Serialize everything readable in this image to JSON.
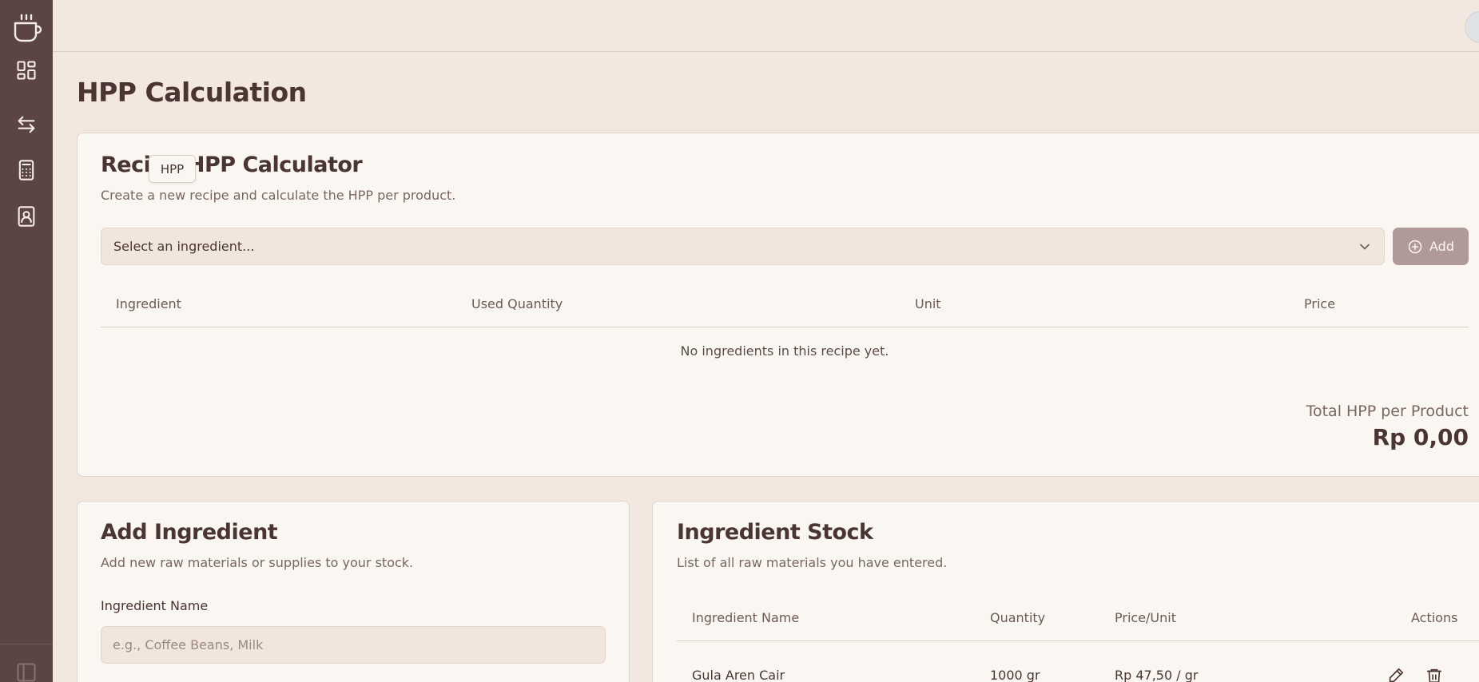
{
  "sidebar": {
    "items": [
      {
        "name": "coffee-cup-logo-icon"
      },
      {
        "name": "dashboard-grid-icon"
      },
      {
        "name": "transfer-arrows-icon"
      },
      {
        "name": "calculator-icon"
      },
      {
        "name": "contact-book-icon"
      },
      {
        "name": "collapse-sidebar-icon"
      }
    ]
  },
  "page": {
    "title": "HPP Calculation"
  },
  "tooltip": {
    "text": "HPP"
  },
  "recipe": {
    "title": "Recipe HPP Calculator",
    "subtitle": "Create a new recipe and calculate the HPP per product.",
    "select_value": "Select an ingredient...",
    "add_label": "Add",
    "columns": [
      "Ingredient",
      "Used Quantity",
      "Unit",
      "Price"
    ],
    "empty_text": "No ingredients in this recipe yet.",
    "total_label": "Total HPP per Product",
    "total_value": "Rp 0,00"
  },
  "add_ingredient": {
    "title": "Add Ingredient",
    "subtitle": "Add new raw materials or supplies to your stock.",
    "name_label": "Ingredient Name",
    "name_placeholder": "e.g., Coffee Beans, Milk"
  },
  "stock": {
    "title": "Ingredient Stock",
    "subtitle": "List of all raw materials you have entered.",
    "columns": [
      "Ingredient Name",
      "Quantity",
      "Price/Unit",
      "Actions"
    ],
    "rows": [
      {
        "name": "Gula Aren Cair",
        "quantity": "1000 gr",
        "price_unit": "Rp 47,50 / gr"
      }
    ]
  },
  "colors": {
    "sidebar": "#5a4444",
    "background": "#f2e8df",
    "card": "#faf6f2",
    "accent_button": "#b09a98",
    "text": "#4a3533"
  }
}
